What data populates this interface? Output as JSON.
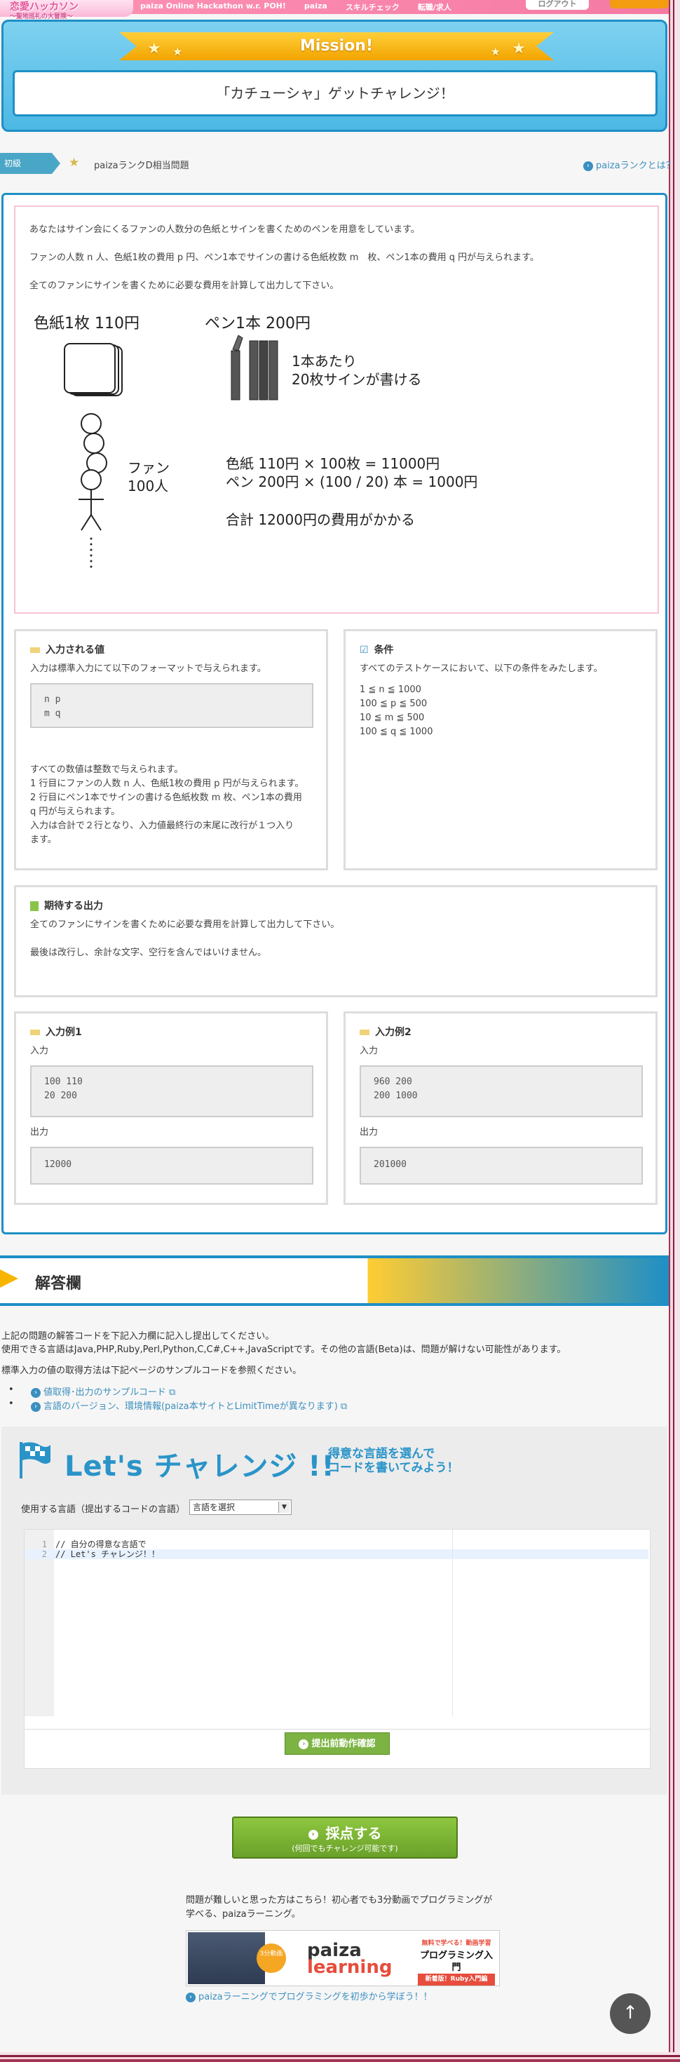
{
  "header": {
    "logo_text": "恋愛ハッカソン",
    "logo_sub": "〜聖地巡礼の大冒険〜",
    "nav": [
      "paiza Online Hackathon w.r. POH!",
      "paiza",
      "スキルチェック",
      "転職/求人"
    ],
    "logout_label": "ログアウト"
  },
  "mission": {
    "ribbon": "Mission!",
    "title": "「カチューシャ」ゲットチャレンジ！"
  },
  "level": {
    "tag": "初級",
    "text": "paizaランクD相当問題",
    "link": "paizaランクとは？"
  },
  "description": {
    "lines": [
      "あなたはサイン会にくるファンの人数分の色紙とサインを書くためのペンを用意をしています。",
      "ファンの人数 n 人、色紙1枚の費用 p 円、ペン1本でサインの書ける色紙枚数 m　枚、ペン1本の費用 q 円が与えられます。",
      "全てのファンにサインを書くために必要な費用を計算して出力して下さい。"
    ],
    "illustration": {
      "paper_label": "色紙1枚 110円",
      "pen_label": "ペン1本 200円",
      "pen_note": [
        "1本あたり",
        "20枚サインが書ける"
      ],
      "fan_label": [
        "ファン",
        "100人"
      ],
      "calc": [
        "色紙 110円 × 100枚 = 11000円",
        "ペン 200円 × (100 / 20) 本 = 1000円"
      ],
      "total": "合計 12000円の費用がかかる"
    }
  },
  "input_panel": {
    "heading": "入力される値",
    "intro": "入力は標準入力にて以下のフォーマットで与えられます。",
    "format": [
      "n p",
      "m q"
    ],
    "notes": [
      "すべての数値は整数で与えられます。",
      "1 行目にファンの人数 n 人、色紙1枚の費用 p 円が与えられます。",
      "2 行目にペン1本でサインの書ける色紙枚数 m 枚、ペン1本の費用",
      "q 円が与えられます。",
      "入力は合計で２行となり、入力値最終行の末尾に改行が１つ入り",
      "ます。"
    ]
  },
  "conditions_panel": {
    "heading": "条件",
    "intro": "すべてのテストケースにおいて、以下の条件をみたします。",
    "items": [
      "1 ≦ n ≦ 1000",
      "100 ≦ p ≦ 500",
      "10 ≦ m ≦ 500",
      "100 ≦ q ≦ 1000"
    ]
  },
  "output_panel": {
    "heading": "期待する出力",
    "lines": [
      "全てのファンにサインを書くために必要な費用を計算して出力して下さい。",
      "最後は改行し、余計な文字、空行を含んではいけません。"
    ]
  },
  "examples": [
    {
      "heading": "入力例1",
      "input_label": "入力",
      "input": [
        "100 110",
        "20 200"
      ],
      "output_label": "出力",
      "output": "12000"
    },
    {
      "heading": "入力例2",
      "input_label": "入力",
      "input": [
        "960 200",
        "200 1000"
      ],
      "output_label": "出力",
      "output": "201000"
    }
  ],
  "answer": {
    "title": "解答欄",
    "text": [
      "上記の問題の解答コードを下記入力欄に記入し提出してください。",
      "使用できる言語はJava,PHP,Ruby,Perl,Python,C,C#,C++,JavaScriptです。その他の言語(Beta)は、問題が解けない可能性があります。",
      "標準入力の値の取得方法は下記ページのサンプルコードを参照ください。"
    ],
    "links": [
      "値取得･出力のサンプルコード",
      "言語のバージョン、環境情報(paiza本サイトとLimitTimeが異なります)"
    ],
    "lets": "Let's チャレンジ !!",
    "lets_sub": [
      "得意な言語を選んで",
      "コードを書いてみよう！"
    ],
    "lang_label": "使用する言語（提出するコードの言語）",
    "lang_select": "言語を選択",
    "code": [
      {
        "ln": "1",
        "text": "// 自分の得意な言語で"
      },
      {
        "ln": "2",
        "text": "// Let's チャレンジ！！"
      }
    ],
    "check_button": "提出前動作確認",
    "submit_main": "採点する",
    "submit_sub": "(何回でもチャレンジ可能です)",
    "learn_text": "問題が難しいと思った方はこちら！初心者でも3分動画でプログラミングが学べる、paizaラーニング。",
    "banner": {
      "badge": "3分動画",
      "logo_top": "paiza",
      "logo_bottom": "learning",
      "promo_small": "無料で学べる！動画学習",
      "promo_main": "プログラミング入門",
      "promo_red": "新着版！Ruby入門編"
    },
    "learn_link": "paizaラーニングでプログラミングを初歩から学ぼう！！"
  },
  "colors": {
    "accent_blue": "#1e8fc6",
    "pink": "#f47aa3",
    "green": "#7cb342",
    "ribbon": "#f2a400"
  }
}
